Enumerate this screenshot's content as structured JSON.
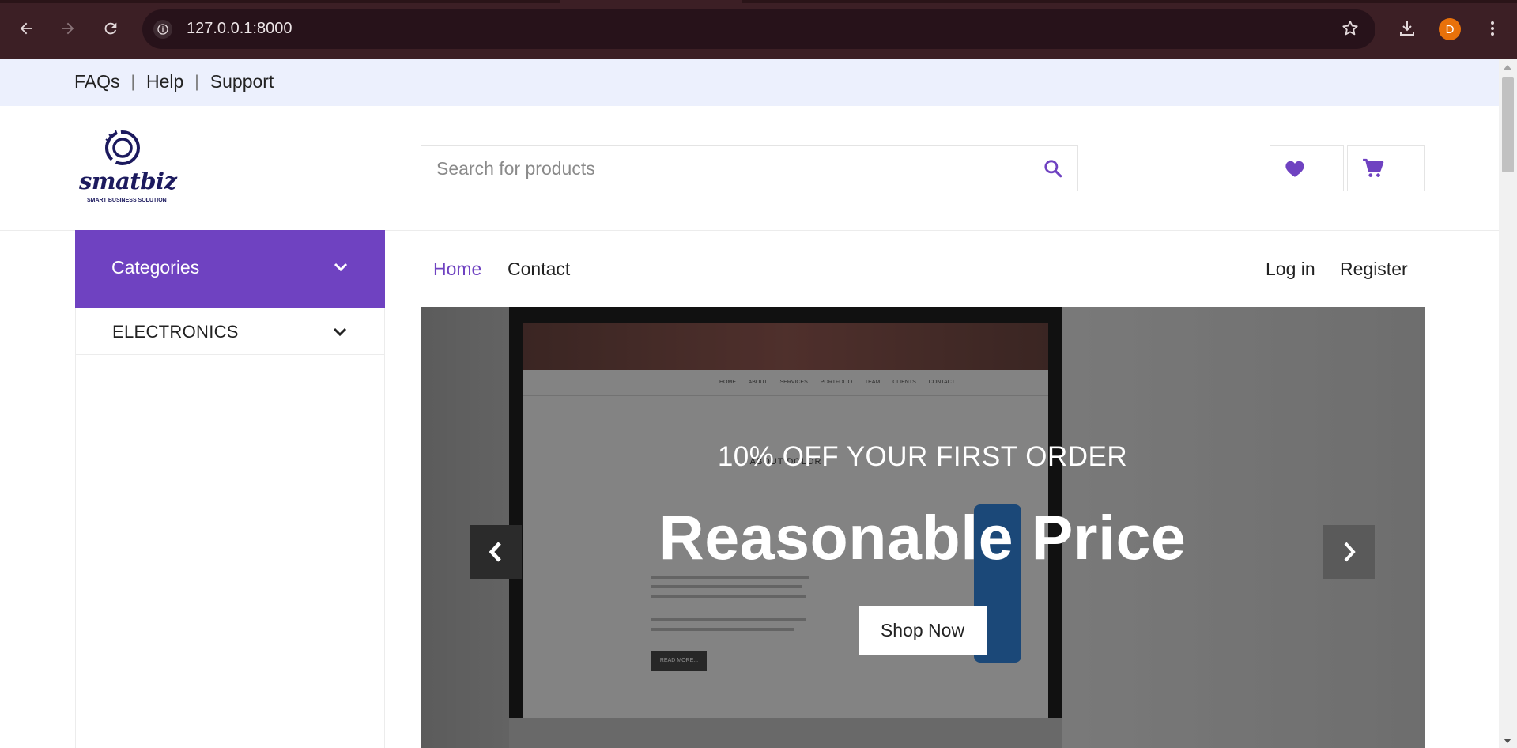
{
  "browser": {
    "url": "127.0.0.1:8000",
    "profile_initial": "D",
    "icons": [
      "back-icon",
      "forward-icon",
      "reload-icon",
      "site-info-icon",
      "bookmark-star-icon",
      "download-icon",
      "more-menu-icon"
    ]
  },
  "topbar": {
    "links": [
      "FAQs",
      "Help",
      "Support"
    ],
    "separator": "|"
  },
  "header": {
    "logo_text": "smatbiz",
    "logo_tagline": "SMART BUSINESS SOLUTION",
    "search_placeholder": "Search for products",
    "accent_color": "#6f42c1"
  },
  "sidebar": {
    "title": "Categories",
    "items": [
      {
        "label": "ELECTRONICS"
      }
    ]
  },
  "nav": {
    "left": [
      {
        "label": "Home",
        "active": true
      },
      {
        "label": "Contact",
        "active": false
      }
    ],
    "right": [
      {
        "label": "Log in"
      },
      {
        "label": "Register"
      }
    ]
  },
  "carousel": {
    "subtitle": "10% OFF YOUR FIRST ORDER",
    "title": "Reasonable Price",
    "button": "Shop Now"
  },
  "mock_screen": {
    "menu": "HOME ABOUT SERVICES PORTFOLIO TEAM CLIENTS CONTACT",
    "heading": "ABOUT DOLOR",
    "button": "READ MORE..."
  }
}
